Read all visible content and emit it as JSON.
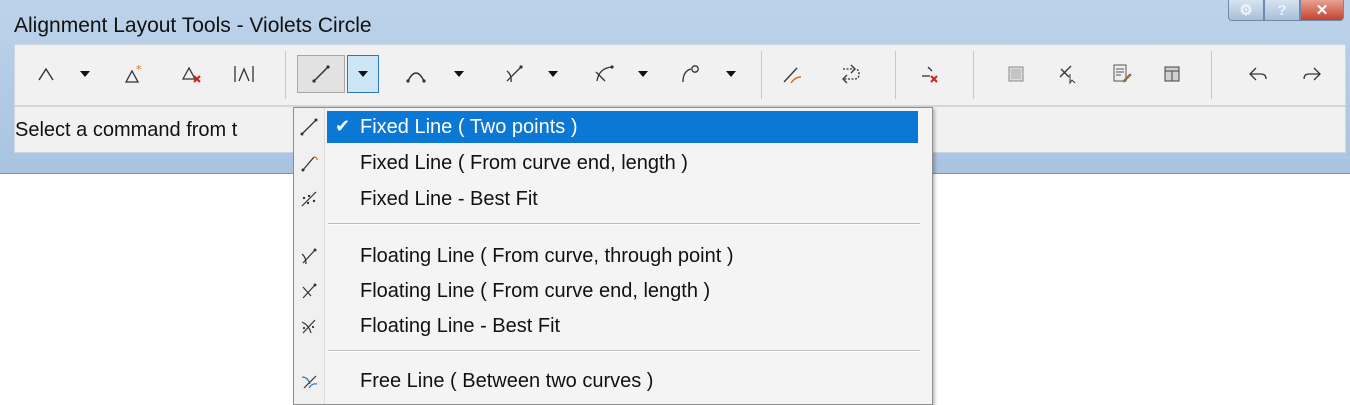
{
  "window": {
    "title": "Alignment Layout Tools - Violets Circle"
  },
  "toolbar": {
    "buttons": [
      {
        "name": "alignment-point-icon"
      },
      {
        "name": "add-point-icon"
      },
      {
        "name": "delete-point-icon"
      },
      {
        "name": "point-info-icon"
      },
      {
        "name": "fixed-line-icon"
      },
      {
        "name": "fixed-curve-icon"
      },
      {
        "name": "floating-line-icon"
      },
      {
        "name": "floating-curve-icon"
      },
      {
        "name": "spiral-icon"
      },
      {
        "name": "reverse-curve-icon"
      },
      {
        "name": "reverse-direction-icon"
      },
      {
        "name": "delete-entity-icon"
      },
      {
        "name": "view-table-icon"
      },
      {
        "name": "edit-pi-icon"
      },
      {
        "name": "edit-properties-icon"
      },
      {
        "name": "grid-view-icon"
      },
      {
        "name": "undo-icon"
      },
      {
        "name": "redo-icon"
      }
    ]
  },
  "status": {
    "text": "Select a command from t"
  },
  "menu": {
    "items": [
      {
        "label": "Fixed Line ( Two points )",
        "checked": true
      },
      {
        "label": "Fixed Line ( From curve end, length )"
      },
      {
        "label": "Fixed Line - Best Fit"
      },
      {
        "label": "Floating Line  ( From curve, through point )"
      },
      {
        "label": "Floating Line  ( From curve end, length )"
      },
      {
        "label": "Floating Line - Best Fit"
      },
      {
        "label": "Free Line   ( Between two curves )"
      }
    ]
  },
  "colors": {
    "highlight": "#0b78d6",
    "title_bar": "#bcd3ea",
    "close_button": "#c3432c"
  }
}
